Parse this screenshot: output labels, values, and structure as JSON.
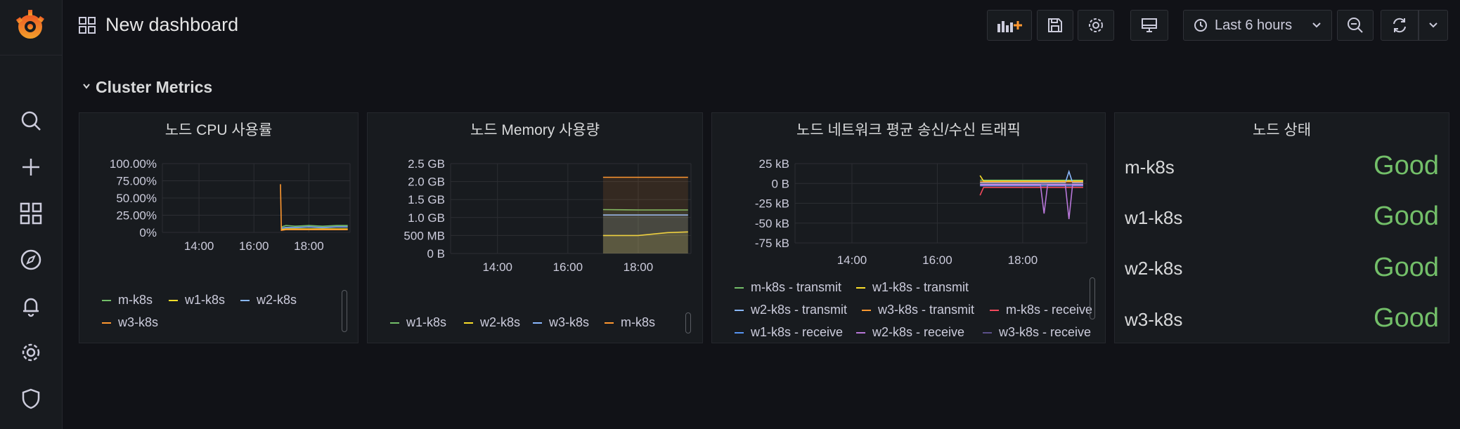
{
  "topbar": {
    "title": "New dashboard",
    "time_range": "Last 6 hours"
  },
  "sidebar": {
    "items": [
      "search-icon",
      "plus-icon",
      "dashboards-icon",
      "explore-icon",
      "alerting-icon",
      "gear-icon",
      "shield-icon"
    ]
  },
  "row": {
    "title": "Cluster Metrics"
  },
  "colors": {
    "green": "#73bf69",
    "yellow": "#fade2a",
    "cyan": "#8ab8ff",
    "orange": "#ff9830",
    "red": "#f2495c",
    "blue": "#5794f2",
    "purple": "#b877d9",
    "good": "#73bf69"
  },
  "panels": [
    {
      "title": "노드 CPU 사용률",
      "legend": [
        "m-k8s",
        "w1-k8s",
        "w2-k8s",
        "w3-k8s"
      ],
      "chart_data": {
        "type": "line",
        "y_ticks": [
          "100.00%",
          "75.00%",
          "50.00%",
          "25.00%",
          "0%"
        ],
        "x_ticks": [
          "14:00",
          "16:00",
          "18:00"
        ],
        "ylim": [
          0,
          100
        ],
        "series": [
          {
            "name": "m-k8s",
            "color": "#73bf69",
            "x": [
              "17:00",
              "17:10",
              "17:30",
              "18:00",
              "18:30",
              "19:00",
              "19:25"
            ],
            "values": [
              8,
              10,
              9,
              10,
              9,
              10,
              10
            ]
          },
          {
            "name": "w1-k8s",
            "color": "#fade2a",
            "x": [
              "17:00",
              "17:10",
              "17:30",
              "18:00",
              "18:30",
              "19:00",
              "19:25"
            ],
            "values": [
              4,
              5,
              5,
              5,
              5,
              5,
              5
            ]
          },
          {
            "name": "w2-k8s",
            "color": "#8ab8ff",
            "x": [
              "17:00",
              "17:10",
              "17:30",
              "18:00",
              "18:30",
              "19:00",
              "19:25"
            ],
            "values": [
              6,
              7,
              7,
              8,
              7,
              8,
              8
            ]
          },
          {
            "name": "w3-k8s",
            "color": "#ff9830",
            "x": [
              "16:58",
              "17:00",
              "17:10",
              "17:30",
              "18:00",
              "18:30",
              "19:00",
              "19:25"
            ],
            "values": [
              70,
              3,
              4,
              4,
              4,
              4,
              4,
              4
            ]
          }
        ]
      }
    },
    {
      "title": "노드 Memory 사용량",
      "legend": [
        "w1-k8s",
        "w2-k8s",
        "w3-k8s",
        "m-k8s"
      ],
      "chart_data": {
        "type": "area",
        "y_ticks": [
          "2.5 GB",
          "2.0 GB",
          "1.5 GB",
          "1.0 GB",
          "500 MB",
          "0 B"
        ],
        "x_ticks": [
          "14:00",
          "16:00",
          "18:00"
        ],
        "ylim": [
          0,
          2.5
        ],
        "series": [
          {
            "name": "w1-k8s",
            "color": "#73bf69",
            "x": [
              "17:00",
              "18:00",
              "19:25"
            ],
            "values": [
              1.22,
              1.21,
              1.21
            ]
          },
          {
            "name": "w2-k8s",
            "color": "#fade2a",
            "x": [
              "17:00",
              "18:00",
              "18:50",
              "19:25"
            ],
            "values": [
              0.5,
              0.5,
              0.58,
              0.6
            ]
          },
          {
            "name": "w3-k8s",
            "color": "#8ab8ff",
            "x": [
              "17:00",
              "18:00",
              "19:25"
            ],
            "values": [
              1.07,
              1.07,
              1.07
            ]
          },
          {
            "name": "m-k8s",
            "color": "#ff9830",
            "x": [
              "17:00",
              "18:00",
              "19:25"
            ],
            "values": [
              2.12,
              2.12,
              2.12
            ]
          }
        ]
      }
    },
    {
      "title": "노드 네트워크 평균 송신/수신 트래픽",
      "legend": [
        "m-k8s - transmit",
        "w1-k8s - transmit",
        "w2-k8s - transmit",
        "w3-k8s - transmit",
        "m-k8s - receive",
        "w1-k8s - receive",
        "w2-k8s - receive",
        "w3-k8s - receive"
      ],
      "chart_data": {
        "type": "line",
        "y_ticks": [
          "25 kB",
          "0 B",
          "-25 kB",
          "-50 kB",
          "-75 kB"
        ],
        "x_ticks": [
          "14:00",
          "16:00",
          "18:00"
        ],
        "ylim": [
          -75,
          25
        ],
        "series": [
          {
            "name": "m-k8s - transmit",
            "color": "#73bf69",
            "x": [
              "17:00",
              "18:00",
              "19:25"
            ],
            "values": [
              4,
              4,
              4
            ]
          },
          {
            "name": "w1-k8s - transmit",
            "color": "#fade2a",
            "x": [
              "17:00",
              "17:05",
              "18:00",
              "19:25"
            ],
            "values": [
              10,
              3,
              3,
              3
            ]
          },
          {
            "name": "w2-k8s - transmit",
            "color": "#8ab8ff",
            "x": [
              "17:00",
              "18:00",
              "19:00",
              "19:05",
              "19:10",
              "19:25"
            ],
            "values": [
              1,
              1,
              1,
              15,
              1,
              1
            ]
          },
          {
            "name": "w3-k8s - transmit",
            "color": "#ff9830",
            "x": [
              "17:00",
              "18:00",
              "19:25"
            ],
            "values": [
              2,
              2,
              2
            ]
          },
          {
            "name": "m-k8s - receive",
            "color": "#f2495c",
            "x": [
              "17:00",
              "17:05",
              "18:00",
              "19:25"
            ],
            "values": [
              -15,
              -5,
              -5,
              -5
            ]
          },
          {
            "name": "w1-k8s - receive",
            "color": "#5794f2",
            "x": [
              "17:00",
              "18:00",
              "19:25"
            ],
            "values": [
              -3,
              -3,
              -3
            ]
          },
          {
            "name": "w2-k8s - receive",
            "color": "#b877d9",
            "x": [
              "17:00",
              "18:25",
              "18:30",
              "18:35",
              "19:00",
              "19:05",
              "19:10",
              "19:25"
            ],
            "values": [
              -2,
              -2,
              -38,
              -2,
              -2,
              -45,
              -2,
              -2
            ]
          },
          {
            "name": "w3-k8s - receive",
            "color": "#ca95e5",
            "x": [
              "17:00",
              "18:00",
              "19:25"
            ],
            "values": [
              -1,
              -1,
              -1
            ]
          }
        ]
      }
    },
    {
      "title": "노드 상태",
      "stats": [
        {
          "name": "m-k8s",
          "value": "Good"
        },
        {
          "name": "w1-k8s",
          "value": "Good"
        },
        {
          "name": "w2-k8s",
          "value": "Good"
        },
        {
          "name": "w3-k8s",
          "value": "Good"
        }
      ]
    }
  ]
}
